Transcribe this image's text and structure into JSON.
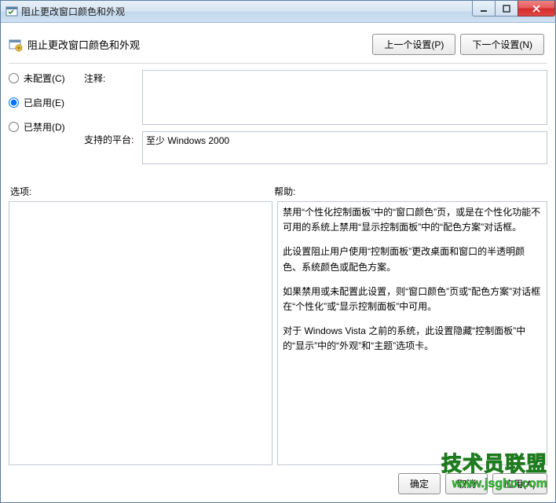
{
  "window": {
    "title": "阻止更改窗口颜色和外观"
  },
  "header": {
    "policy_name": "阻止更改窗口颜色和外观",
    "prev_button": "上一个设置(P)",
    "next_button": "下一个设置(N)"
  },
  "state": {
    "not_configured": "未配置(C)",
    "enabled": "已启用(E)",
    "disabled": "已禁用(D)",
    "selected": "enabled"
  },
  "comment": {
    "label": "注释:",
    "value": ""
  },
  "platform": {
    "label": "支持的平台:",
    "value": "至少 Windows 2000"
  },
  "options": {
    "label": "选项:"
  },
  "help": {
    "label": "帮助:",
    "paragraphs": [
      "禁用“个性化控制面板”中的“窗口颜色”页，或是在个性化功能不可用的系统上禁用“显示控制面板”中的“配色方案”对话框。",
      "此设置阻止用户使用“控制面板”更改桌面和窗口的半透明颜色、系统颜色或配色方案。",
      "如果禁用或未配置此设置，则“窗口颜色”页或“配色方案”对话框在“个性化”或“显示控制面板”中可用。",
      "对于 Windows Vista 之前的系统，此设置隐藏“控制面板”中的“显示”中的“外观”和“主题”选项卡。"
    ]
  },
  "buttons": {
    "ok": "确定",
    "cancel": "取消",
    "apply": "应用(A)"
  },
  "watermark": {
    "line1": "技术员联盟",
    "line2": "www.jsgho.com"
  }
}
